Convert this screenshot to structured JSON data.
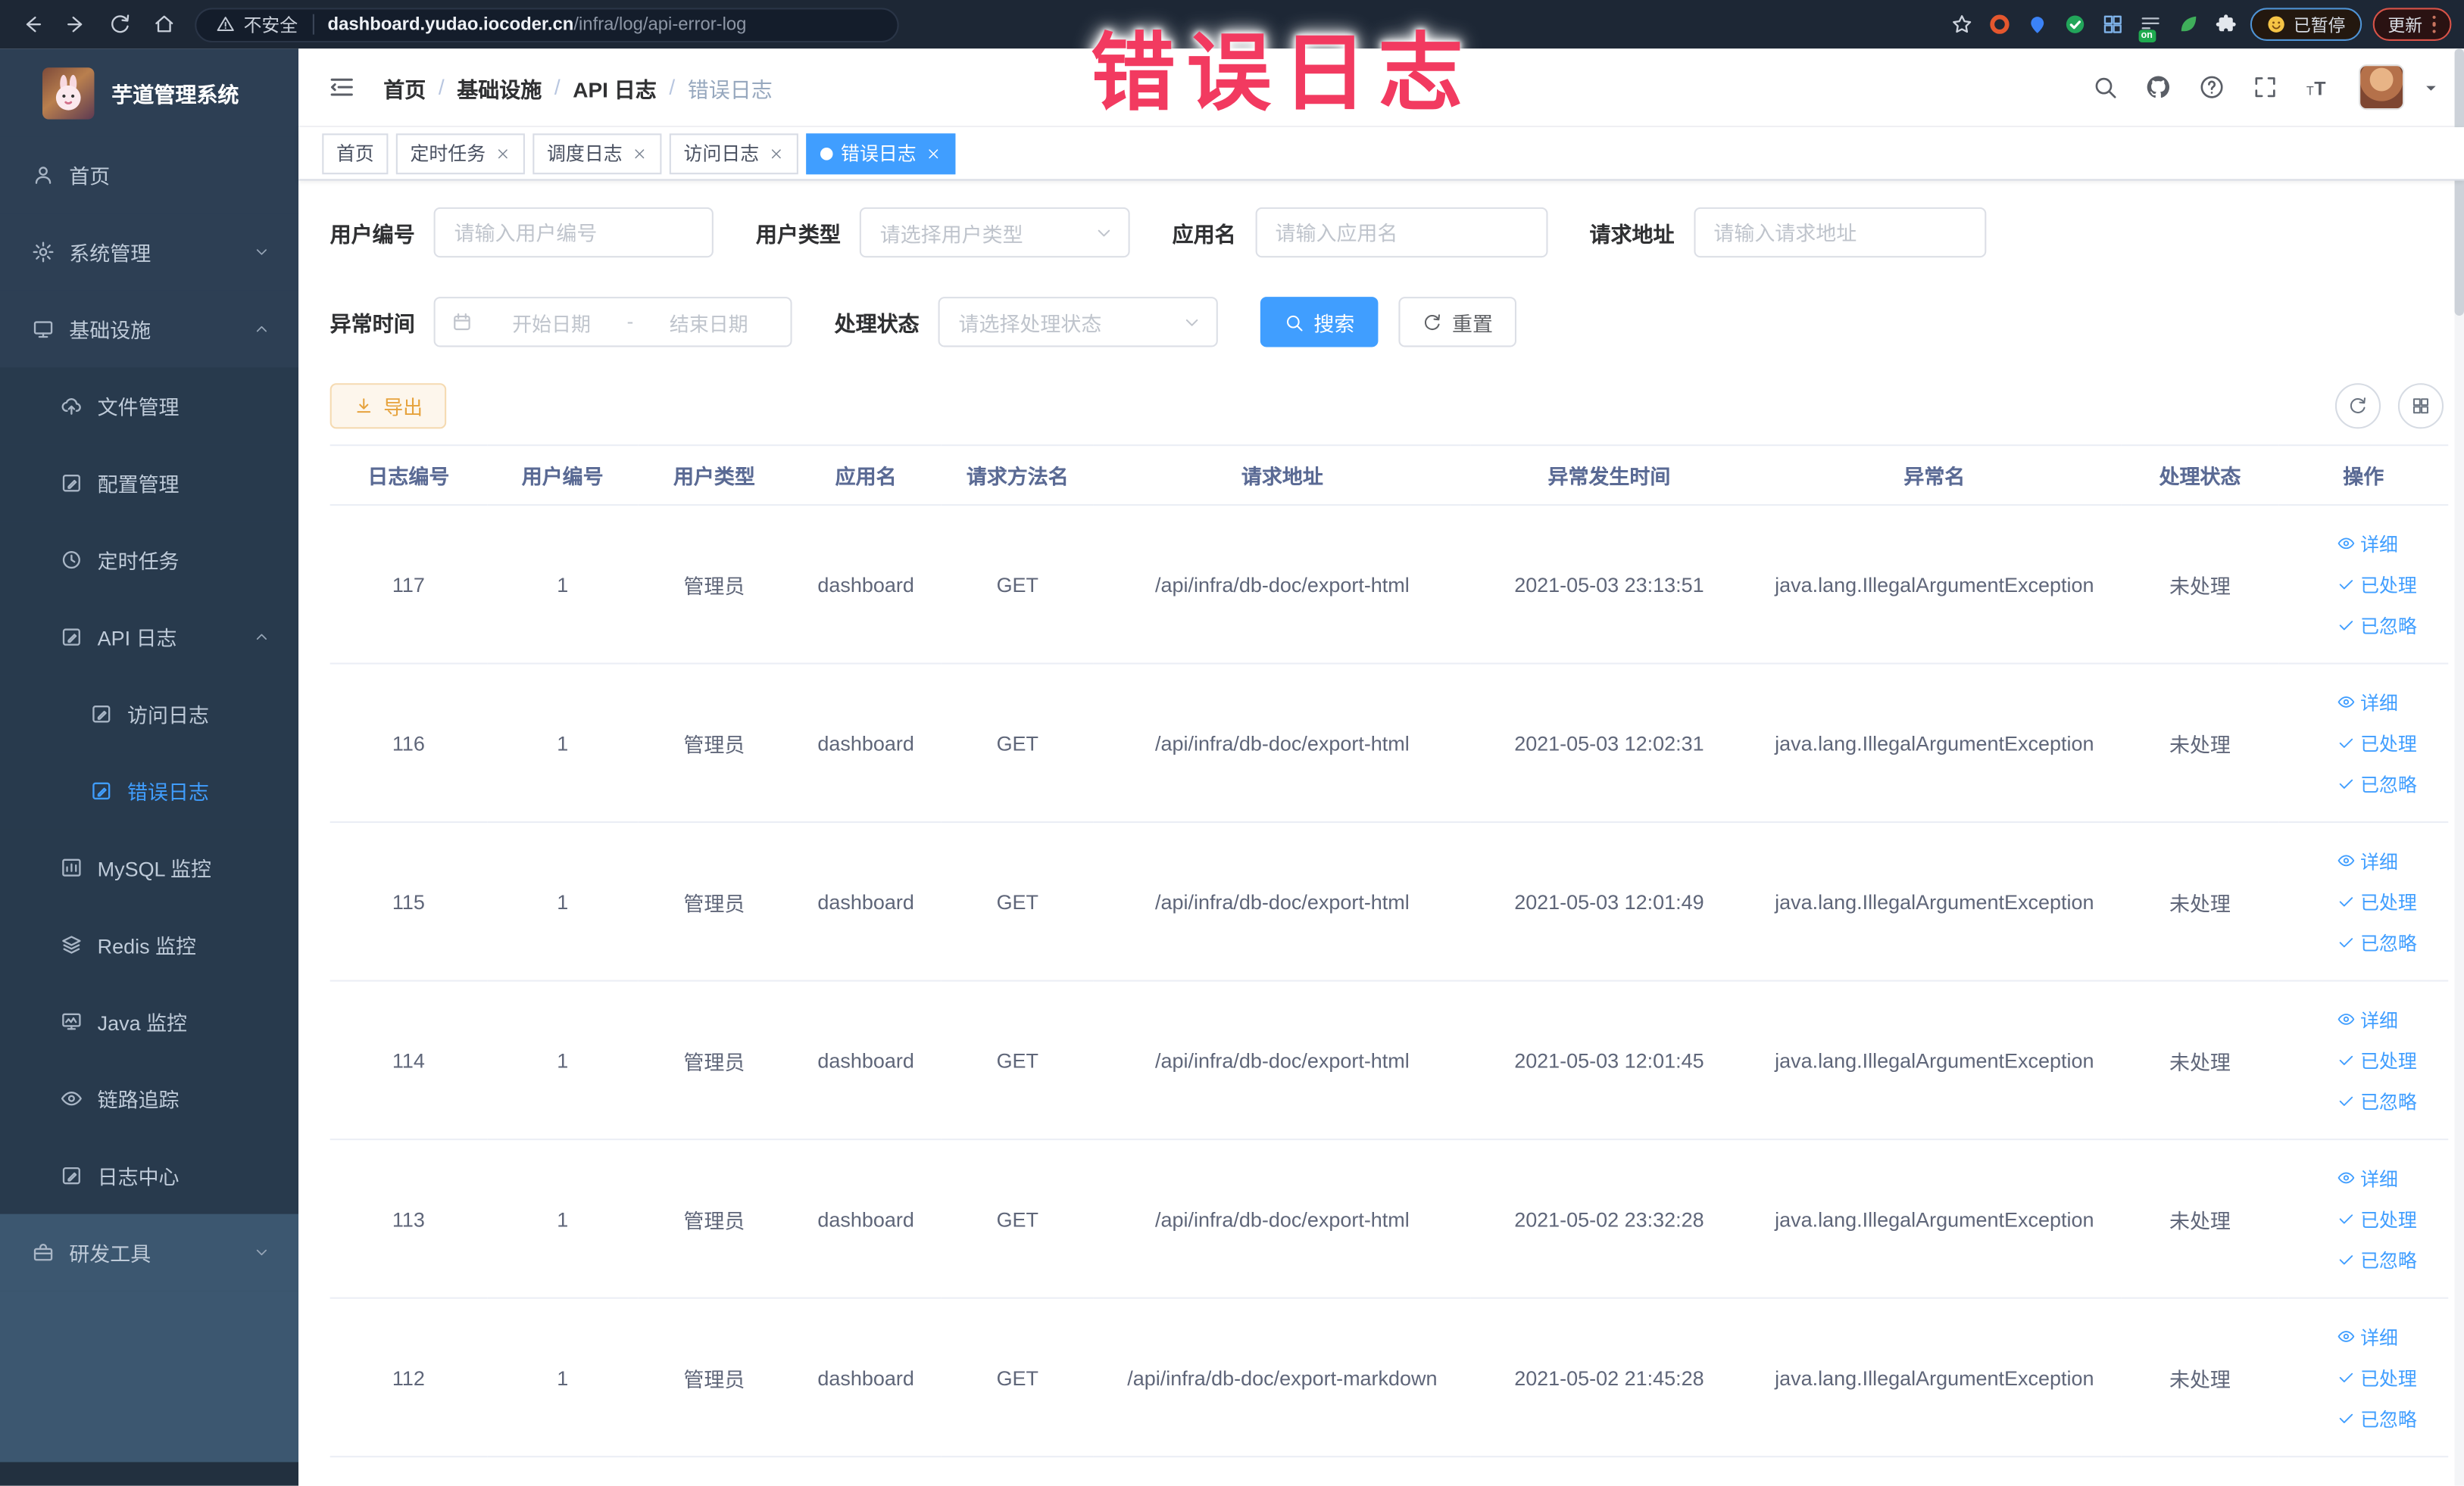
{
  "colors": {
    "accent": "#409eff",
    "active_tab": "#409eff",
    "annotation": "#f23a60",
    "warn_button": "#e6a23c",
    "sidebar_bg": "#2d3f54",
    "chrome_bg": "#1d2735"
  },
  "browser": {
    "nav_icons": [
      "back",
      "forward",
      "reload",
      "home"
    ],
    "security_warning": "不安全",
    "url_host": "dashboard.yudao.iocoder.cn",
    "url_path": "/infra/log/api-error-log",
    "extension_icons": [
      "star",
      "ring",
      "pin",
      "check-circle",
      "grid4",
      "list-on",
      "leaf",
      "puzzle"
    ],
    "on_badge": "on",
    "paused_badge": "已暂停",
    "update_button": "更新"
  },
  "annotation": {
    "text": "错误日志"
  },
  "sidebar": {
    "title": "芋道管理系统",
    "items": [
      {
        "label": "首页",
        "icon": "person",
        "level": 0
      },
      {
        "label": "系统管理",
        "icon": "gear",
        "level": 0,
        "arrow": "down"
      },
      {
        "label": "基础设施",
        "icon": "monitor",
        "level": 0,
        "arrow": "up"
      },
      {
        "label": "文件管理",
        "icon": "cloud-upload",
        "level": 1
      },
      {
        "label": "配置管理",
        "icon": "pencil-square",
        "level": 1
      },
      {
        "label": "定时任务",
        "icon": "clock",
        "level": 1
      },
      {
        "label": "API 日志",
        "icon": "doc-edit",
        "level": 1,
        "arrow": "up"
      },
      {
        "label": "访问日志",
        "icon": "doc-edit",
        "level": 2
      },
      {
        "label": "错误日志",
        "icon": "doc-edit",
        "level": 2,
        "active": true
      },
      {
        "label": "MySQL 监控",
        "icon": "chart",
        "level": 1
      },
      {
        "label": "Redis 监控",
        "icon": "layers",
        "level": 1
      },
      {
        "label": "Java 监控",
        "icon": "java-monitor",
        "level": 1
      },
      {
        "label": "链路追踪",
        "icon": "eye",
        "level": 1
      },
      {
        "label": "日志中心",
        "icon": "doc-edit",
        "level": 1
      },
      {
        "label": "研发工具",
        "icon": "toolbox",
        "level": 0,
        "arrow": "down",
        "zone": "light"
      }
    ]
  },
  "header": {
    "breadcrumb": [
      "首页",
      "基础设施",
      "API 日志",
      "错误日志"
    ],
    "icons": [
      "search",
      "github",
      "help",
      "fullscreen",
      "text-size"
    ]
  },
  "tabs": [
    {
      "label": "首页",
      "closable": false,
      "active": false
    },
    {
      "label": "定时任务",
      "closable": true,
      "active": false
    },
    {
      "label": "调度日志",
      "closable": true,
      "active": false
    },
    {
      "label": "访问日志",
      "closable": true,
      "active": false
    },
    {
      "label": "错误日志",
      "closable": true,
      "active": true
    }
  ],
  "filters": {
    "user_id": {
      "label": "用户编号",
      "placeholder": "请输入用户编号"
    },
    "user_type": {
      "label": "用户类型",
      "placeholder": "请选择用户类型"
    },
    "app_name": {
      "label": "应用名",
      "placeholder": "请输入应用名"
    },
    "request_url": {
      "label": "请求地址",
      "placeholder": "请输入请求地址"
    },
    "exception_time": {
      "label": "异常时间",
      "start_placeholder": "开始日期",
      "separator": "-",
      "end_placeholder": "结束日期"
    },
    "process_status": {
      "label": "处理状态",
      "placeholder": "请选择处理状态"
    }
  },
  "buttons": {
    "search": "搜索",
    "reset": "重置",
    "export": "导出"
  },
  "table": {
    "headers": [
      "日志编号",
      "用户编号",
      "用户类型",
      "应用名",
      "请求方法名",
      "请求地址",
      "异常发生时间",
      "异常名",
      "处理状态",
      "操作"
    ],
    "row_actions": [
      {
        "label": "详细",
        "icon": "eye"
      },
      {
        "label": "已处理",
        "icon": "check"
      },
      {
        "label": "已忽略",
        "icon": "check"
      }
    ],
    "rows": [
      {
        "id": "117",
        "user_id": "1",
        "user_type": "管理员",
        "app": "dashboard",
        "method": "GET",
        "url": "/api/infra/db-doc/export-html",
        "time": "2021-05-03 23:13:51",
        "exception": "java.lang.IllegalArgumentException",
        "status": "未处理"
      },
      {
        "id": "116",
        "user_id": "1",
        "user_type": "管理员",
        "app": "dashboard",
        "method": "GET",
        "url": "/api/infra/db-doc/export-html",
        "time": "2021-05-03 12:02:31",
        "exception": "java.lang.IllegalArgumentException",
        "status": "未处理"
      },
      {
        "id": "115",
        "user_id": "1",
        "user_type": "管理员",
        "app": "dashboard",
        "method": "GET",
        "url": "/api/infra/db-doc/export-html",
        "time": "2021-05-03 12:01:49",
        "exception": "java.lang.IllegalArgumentException",
        "status": "未处理"
      },
      {
        "id": "114",
        "user_id": "1",
        "user_type": "管理员",
        "app": "dashboard",
        "method": "GET",
        "url": "/api/infra/db-doc/export-html",
        "time": "2021-05-03 12:01:45",
        "exception": "java.lang.IllegalArgumentException",
        "status": "未处理"
      },
      {
        "id": "113",
        "user_id": "1",
        "user_type": "管理员",
        "app": "dashboard",
        "method": "GET",
        "url": "/api/infra/db-doc/export-html",
        "time": "2021-05-02 23:32:28",
        "exception": "java.lang.IllegalArgumentException",
        "status": "未处理"
      },
      {
        "id": "112",
        "user_id": "1",
        "user_type": "管理员",
        "app": "dashboard",
        "method": "GET",
        "url": "/api/infra/db-doc/export-markdown",
        "time": "2021-05-02 21:45:28",
        "exception": "java.lang.IllegalArgumentException",
        "status": "未处理"
      }
    ]
  }
}
